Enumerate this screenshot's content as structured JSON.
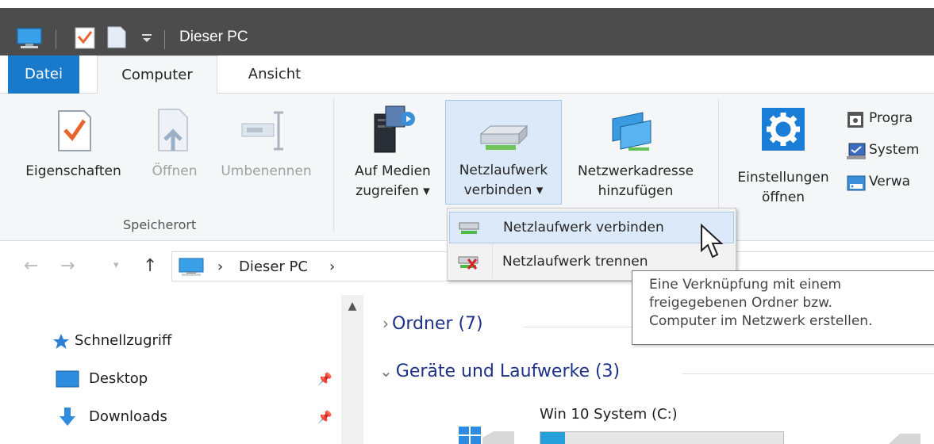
{
  "titlebar": {
    "title": "Dieser PC",
    "icons": [
      "computer-icon",
      "properties-icon",
      "new-folder-icon",
      "customize-dropdown-icon"
    ]
  },
  "tabs": {
    "file": "Datei",
    "computer": "Computer",
    "view": "Ansicht"
  },
  "ribbon": {
    "properties": "Eigenschaften",
    "open": "Öffnen",
    "rename": "Umbenennen",
    "location_group": "Speicherort",
    "media_line1": "Auf Medien",
    "media_line2": "zugreifen ▾",
    "mapdrive_line1": "Netzlaufwerk",
    "mapdrive_line2": "verbinden ▾",
    "netaddr_line1": "Netzwerkadresse",
    "netaddr_line2": "hinzufügen",
    "settings_line1": "Einstellungen",
    "settings_line2": "öffnen",
    "small_programs": "Progra",
    "small_system": "System",
    "small_manage": "Verwa"
  },
  "dropdown": {
    "items": [
      {
        "label": "Netzlaufwerk verbinden",
        "icon": "map-network-drive-icon",
        "hover": true
      },
      {
        "label": "Netzlaufwerk trennen",
        "icon": "disconnect-network-drive-icon",
        "hover": false
      }
    ]
  },
  "tooltip": {
    "line1": "Eine Verknüpfung mit einem",
    "line2": "freigegebenen Ordner bzw.",
    "line3": "Computer im Netzwerk erstellen."
  },
  "addressbar": {
    "crumb": "Dieser PC",
    "sep1": "›",
    "sep2": "›"
  },
  "navpane": {
    "items": [
      {
        "label": "Schnellzugriff",
        "icon": "star-icon"
      },
      {
        "label": "Desktop",
        "icon": "desktop-folder-icon",
        "pinned": true
      },
      {
        "label": "Downloads",
        "icon": "downloads-icon",
        "pinned": true
      }
    ]
  },
  "content": {
    "folders_header": "Ordner (7)",
    "devices_header": "Geräte und Laufwerke (3)",
    "drive": {
      "label": "Win 10 System (C:)",
      "used_fraction": 0.1
    }
  },
  "colors": {
    "titlebar_bg": "#4c4c4c",
    "file_tab": "#1979ca",
    "ribbon_bg": "#f5f6f7",
    "highlight": "#dbe9f8",
    "section_header": "#1e3287"
  }
}
